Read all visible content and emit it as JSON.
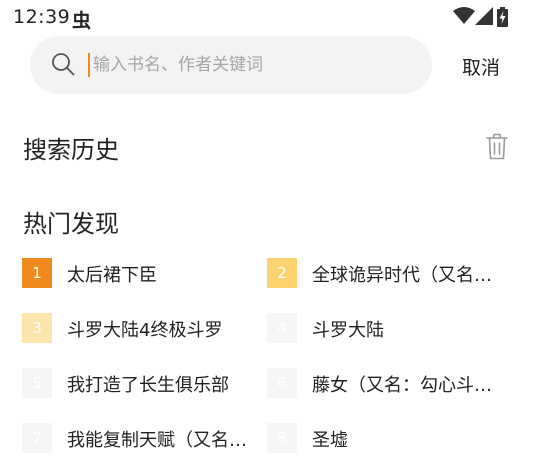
{
  "status_bar": {
    "time": "12:39",
    "app_icon_glyph": "虫",
    "icons": [
      "wifi-icon",
      "cellular-signal-icon",
      "battery-charging-icon"
    ]
  },
  "search": {
    "placeholder": "输入书名、作者关键词",
    "value": "",
    "cancel_label": "取消",
    "caret_color": "#f08a1c"
  },
  "history": {
    "title": "搜索历史",
    "clear_icon": "trash-icon"
  },
  "hot": {
    "title": "热门发现",
    "items": [
      {
        "rank": "1",
        "label": "太后裙下臣",
        "badge_color": "#f08a1c"
      },
      {
        "rank": "2",
        "label": "全球诡异时代（又名：全球诡异时代）",
        "badge_color": "#fcd36e"
      },
      {
        "rank": "3",
        "label": "斗罗大陆4终极斗罗",
        "badge_color": "#fde6ae"
      },
      {
        "rank": "4",
        "label": "斗罗大陆",
        "badge_color": "#f6f6f6"
      },
      {
        "rank": "5",
        "label": "我打造了长生俱乐部",
        "badge_color": "#f6f6f6"
      },
      {
        "rank": "6",
        "label": "藤女（又名：勾心斗角）",
        "badge_color": "#f6f6f6"
      },
      {
        "rank": "7",
        "label": "我能复制天赋（又名：复制天赋）",
        "badge_color": "#f6f6f6"
      },
      {
        "rank": "8",
        "label": "圣墟",
        "badge_color": "#f6f6f6"
      }
    ]
  }
}
